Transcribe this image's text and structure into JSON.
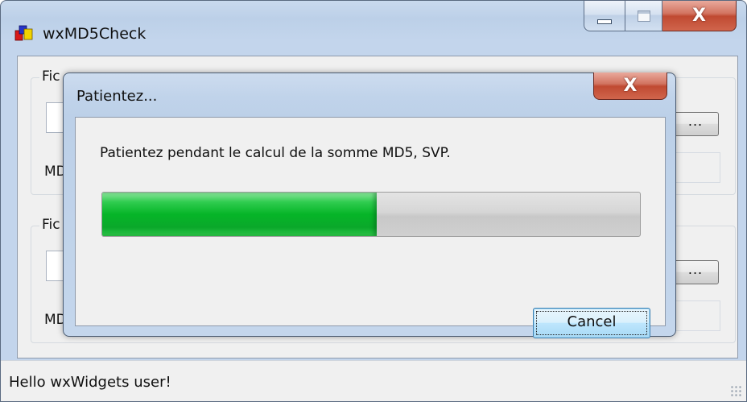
{
  "main_window": {
    "title": "wxMD5Check",
    "icon": "wxwidgets-logo-icon",
    "caption_buttons": {
      "minimize": "minimize-icon",
      "maximize": "maximize-icon",
      "close": "X"
    }
  },
  "group1": {
    "label": "Fic",
    "md5_label": "MD",
    "browse_label": "..."
  },
  "group2": {
    "label": "Fic",
    "md5_label": "MD",
    "browse_label": "..."
  },
  "statusbar": {
    "text": "Hello wxWidgets user!"
  },
  "dialog": {
    "title": "Patientez...",
    "close_label": "X",
    "message": "Patientez pendant le calcul de la somme MD5, SVP.",
    "progress": 0.51,
    "cancel_label": "Cancel"
  },
  "colors": {
    "progress_fill": "#06b528",
    "close_button": "#c04a32",
    "title_bar": "#bcd0e8"
  }
}
